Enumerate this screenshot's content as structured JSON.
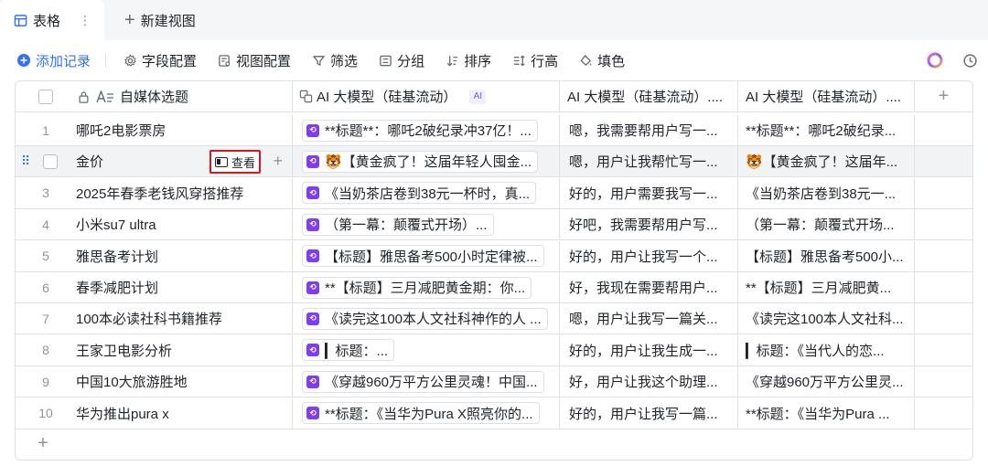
{
  "tabs": {
    "active_label": "表格",
    "menu_glyph": "⋮",
    "new_view_label": "新建视图"
  },
  "toolbar": {
    "add_record": "添加记录",
    "field_config": "字段配置",
    "view_config": "视图配置",
    "filter": "筛选",
    "group": "分组",
    "sort": "排序",
    "row_height": "行高",
    "fill_color": "填色"
  },
  "table": {
    "headers": {
      "title": "自媒体选题",
      "ai1": "AI 大模型（硅基流动）",
      "ai1_badge": "AI",
      "ai2": "AI 大模型（硅基流动）....",
      "ai3": "AI 大模型（硅基流动）...."
    },
    "view_button": "查看",
    "rows": [
      {
        "num": "1",
        "title": "哪吒2电影票房",
        "ai1": "**标题**：哪吒2破纪录冲37亿！...",
        "ai2": "嗯，我需要帮用户写一...",
        "ai3": "**标题**：哪吒2破纪录..."
      },
      {
        "num": "",
        "title": "金价",
        "ai1": "🐯【黄金疯了！这届年轻人囤金...",
        "ai2": "嗯，用户让我帮忙写一...",
        "ai3": "🐯【黄金疯了！这届年..."
      },
      {
        "num": "3",
        "title": "2025年春季老钱风穿搭推荐",
        "ai1": "《当奶茶店卷到38元一杯时，真...",
        "ai2": "好的，用户需要我写一...",
        "ai3": "《当奶茶店卷到38元一..."
      },
      {
        "num": "4",
        "title": "小米su7 ultra",
        "ai1": "（第一幕：颠覆式开场）...",
        "ai2": "好吧，我需要帮用户写...",
        "ai3": "（第一幕：颠覆式开场..."
      },
      {
        "num": "5",
        "title": "雅思备考计划",
        "ai1": "【标题】雅思备考500小时定律被...",
        "ai2": "好的，用户让我写一个...",
        "ai3": "【标题】雅思备考500小..."
      },
      {
        "num": "6",
        "title": "春季减肥计划",
        "ai1": "**【标题】三月减肥黄金期：你...",
        "ai2": "好，我现在需要帮用户...",
        "ai3": "**【标题】三月减肥黄..."
      },
      {
        "num": "7",
        "title": "100本必读社科书籍推荐",
        "ai1": "《读完这100本人文社科神作的人 ...",
        "ai2": "嗯，用户让我写一篇关...",
        "ai3": "《读完这100本人文社科..."
      },
      {
        "num": "8",
        "title": "王家卫电影分析",
        "ai1": "▎标题：...",
        "ai2": "好的，用户让我生成一...",
        "ai3": "▎标题：《当代人的恋..."
      },
      {
        "num": "9",
        "title": "中国10大旅游胜地",
        "ai1": "《穿越960万平方公里灵魂！中国...",
        "ai2": "好，用户让我这个助理...",
        "ai3": "《穿越960万平方公里灵..."
      },
      {
        "num": "10",
        "title": "华为推出pura x",
        "ai1": "**标题：《当华为Pura X照亮你的...",
        "ai2": "好的，用户让我写一篇...",
        "ai3": "**标题：《当华为Pura ..."
      }
    ]
  }
}
